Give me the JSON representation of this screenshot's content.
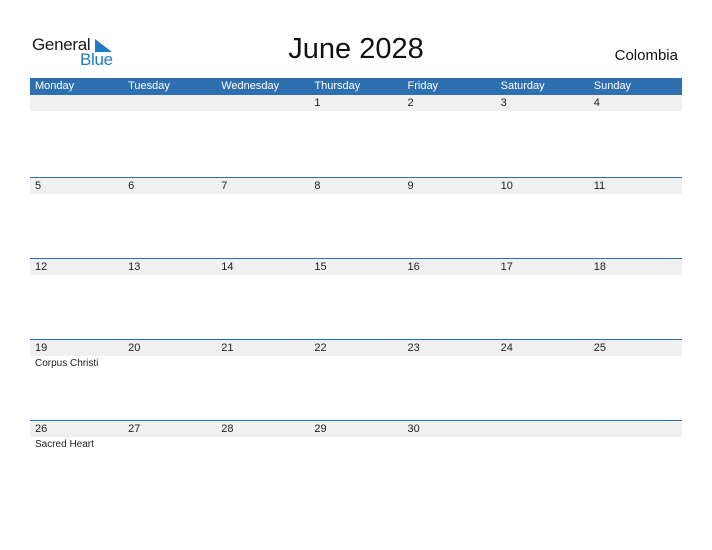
{
  "logo": {
    "word1": "General",
    "word2": "Blue"
  },
  "title": "June 2028",
  "country": "Colombia",
  "colors": {
    "header": "#2e6fb0",
    "brand": "#1e7bc4",
    "band": "#f0f0f0"
  },
  "weekdays": [
    "Monday",
    "Tuesday",
    "Wednesday",
    "Thursday",
    "Friday",
    "Saturday",
    "Sunday"
  ],
  "weeks": [
    {
      "days": [
        "",
        "",
        "",
        "1",
        "2",
        "3",
        "4"
      ],
      "notes": [
        "",
        "",
        "",
        "",
        "",
        "",
        ""
      ]
    },
    {
      "days": [
        "5",
        "6",
        "7",
        "8",
        "9",
        "10",
        "11"
      ],
      "notes": [
        "",
        "",
        "",
        "",
        "",
        "",
        ""
      ]
    },
    {
      "days": [
        "12",
        "13",
        "14",
        "15",
        "16",
        "17",
        "18"
      ],
      "notes": [
        "",
        "",
        "",
        "",
        "",
        "",
        ""
      ]
    },
    {
      "days": [
        "19",
        "20",
        "21",
        "22",
        "23",
        "24",
        "25"
      ],
      "notes": [
        "Corpus Christi",
        "",
        "",
        "",
        "",
        "",
        ""
      ]
    },
    {
      "days": [
        "26",
        "27",
        "28",
        "29",
        "30",
        "",
        ""
      ],
      "notes": [
        "Sacred Heart",
        "",
        "",
        "",
        "",
        "",
        ""
      ]
    }
  ]
}
